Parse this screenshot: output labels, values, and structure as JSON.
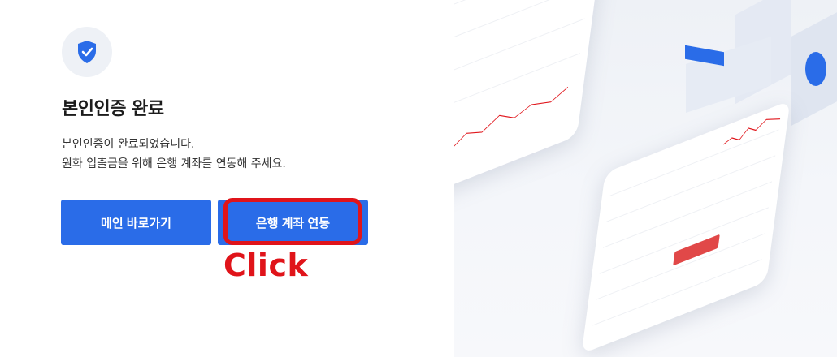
{
  "verify": {
    "title": "본인인증 완료",
    "desc_line1": "본인인증이 완료되었습니다.",
    "desc_line2": "원화 입출금을 위해 은행 계좌를 연동해 주세요."
  },
  "buttons": {
    "main_label": "메인 바로가기",
    "link_label": "은행 계좌 연동"
  },
  "annotation": {
    "click_label": "Click"
  },
  "colors": {
    "accent": "#2a6ce8",
    "highlight": "#e0141a"
  }
}
